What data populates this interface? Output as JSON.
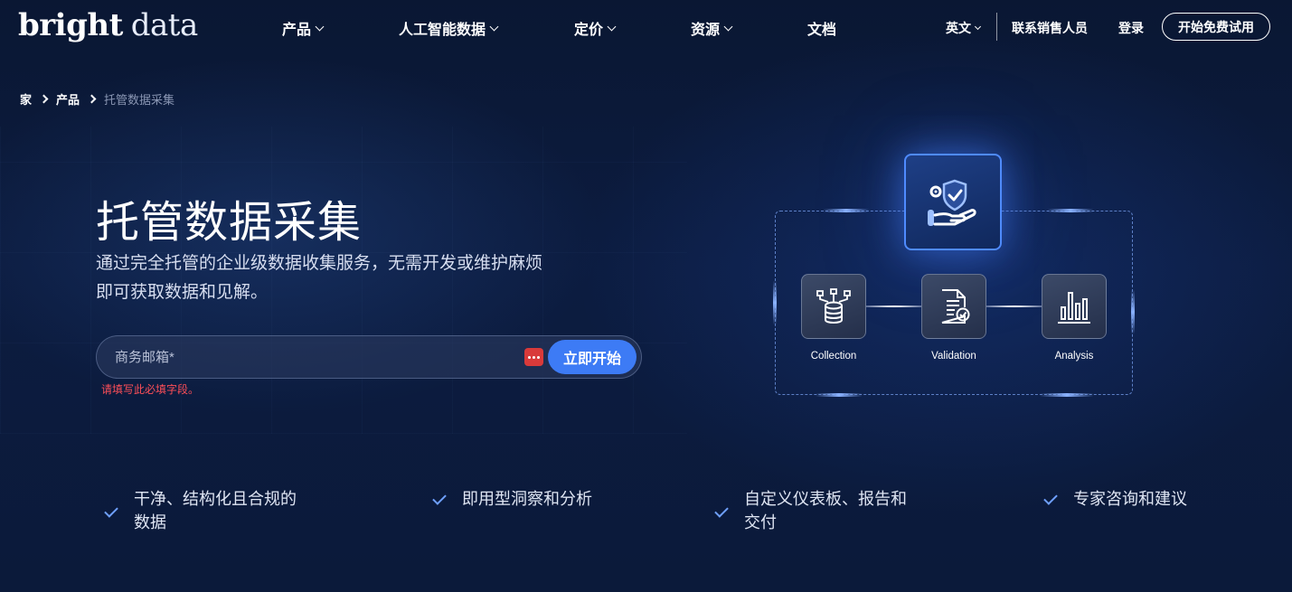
{
  "nav": {
    "logo_bold": "bright",
    "logo_light": "data",
    "items": [
      {
        "label": "产品",
        "dropdown": true
      },
      {
        "label": "人工智能数据",
        "dropdown": true
      },
      {
        "label": "定价",
        "dropdown": true
      },
      {
        "label": "资源",
        "dropdown": true
      },
      {
        "label": "文档",
        "dropdown": false
      }
    ],
    "language": "英文",
    "contact_sales": "联系销售人员",
    "login": "登录",
    "trial_button": "开始免费试用"
  },
  "breadcrumb": {
    "home": "家",
    "products": "产品",
    "current": "托管数据采集"
  },
  "hero": {
    "title": "托管数据采集",
    "subtitle_line1": "通过完全托管的企业级数据收集服务，无需开发或维护麻烦",
    "subtitle_line2": "即可获取数据和见解。",
    "email_placeholder": "商务邮箱*",
    "email_value": "",
    "start_button": "立即开始",
    "error_message": "请填写此必填字段。"
  },
  "diagram": {
    "steps": [
      {
        "label": "Collection",
        "icon": "database-network-icon"
      },
      {
        "label": "Validation",
        "icon": "document-check-icon"
      },
      {
        "label": "Analysis",
        "icon": "bar-chart-icon"
      }
    ],
    "top_icon": "shield-gear-hand-icon"
  },
  "features": [
    {
      "line1": "干净、结构化且合规的",
      "line2": "数据"
    },
    {
      "line1": "即用型洞察和分析",
      "line2": ""
    },
    {
      "line1": "自定义仪表板、报告和",
      "line2": "交付"
    },
    {
      "line1": "专家咨询和建议",
      "line2": ""
    }
  ],
  "colors": {
    "background": "#0b1a3a",
    "accent_button": "#3d7bf5",
    "error": "#ff4f58",
    "check": "#6fa0ff",
    "password_manager_badge": "#d93a3a"
  }
}
